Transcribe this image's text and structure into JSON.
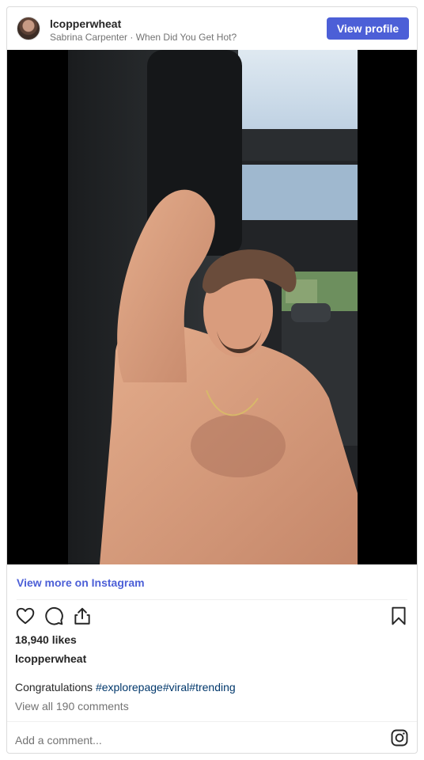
{
  "header": {
    "username": "lcopperwheat",
    "subtitle": "Sabrina Carpenter · When Did You Get Hot?",
    "view_profile_label": "View profile"
  },
  "media": {
    "type": "video"
  },
  "view_more_label": "View more on Instagram",
  "actions": {
    "icons": [
      "heart-icon",
      "comment-icon",
      "share-icon",
      "bookmark-icon"
    ]
  },
  "likes": "18,940 likes",
  "owner": "lcopperwheat",
  "caption": {
    "text": "Congratulations ",
    "hashtags": [
      "#explorepage",
      "#viral",
      "#trending"
    ]
  },
  "comments_link": "View all 190 comments",
  "footer": {
    "add_comment": "Add a comment...",
    "icon": "instagram-icon"
  },
  "colors": {
    "accent": "#4c5fd7",
    "hashtag": "#00376b",
    "muted": "#737373"
  }
}
